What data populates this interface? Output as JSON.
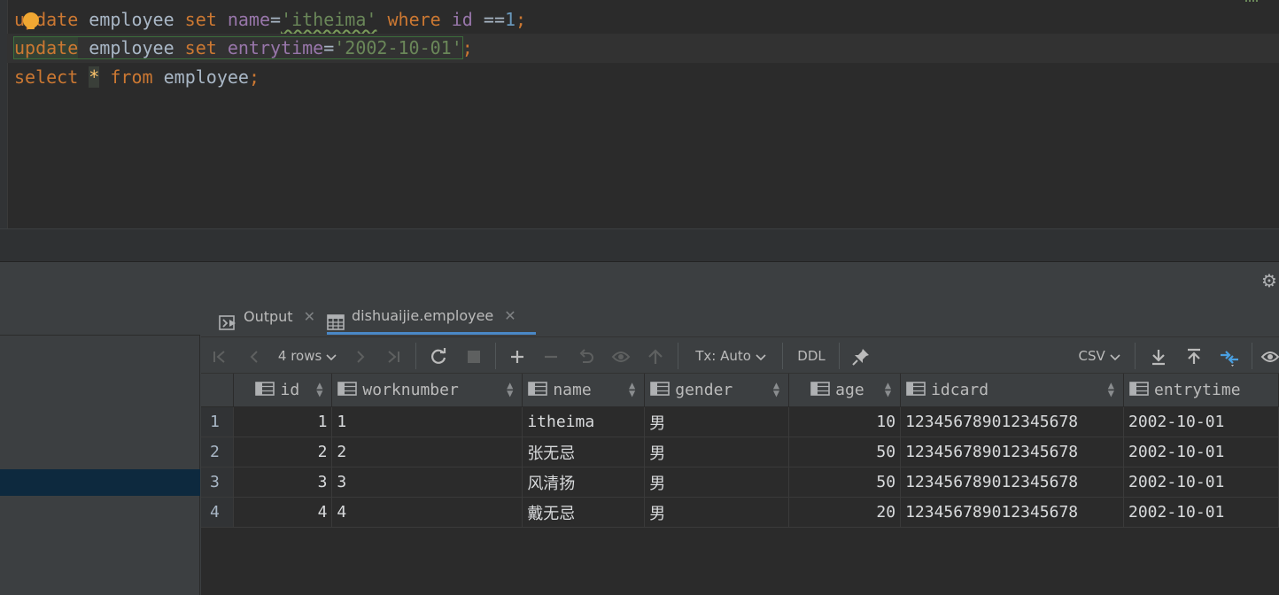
{
  "editor": {
    "lines": [
      {
        "kw1": "update",
        "table": "employee",
        "kw2": "set",
        "col": "name",
        "eq": "=",
        "str": "'itheima'",
        "kw3": "where",
        "col2": "id",
        "op": " =",
        "num": "1",
        "end": ";"
      },
      {
        "kw1": "update",
        "table": "employee",
        "kw2": "set",
        "col": "entrytime",
        "eq": "=",
        "str": "'2002-10-01'",
        "end": ";"
      },
      {
        "kw1": "select",
        "star": "*",
        "kw2": "from",
        "table": "employee",
        "end": ";"
      }
    ]
  },
  "results": {
    "tabs": [
      {
        "label": "Output",
        "icon": "console-icon"
      },
      {
        "label": "dishuaijie.employee",
        "icon": "table-icon",
        "active": true
      }
    ],
    "toolbar": {
      "rows_label": "4 rows",
      "tx_label": "Tx: Auto",
      "ddl_label": "DDL",
      "export_label": "CSV"
    },
    "columns": [
      "id",
      "worknumber",
      "name",
      "gender",
      "age",
      "idcard",
      "entrytime"
    ],
    "rows": [
      {
        "rn": "1",
        "id": "1",
        "worknumber": "1",
        "name": "itheima",
        "gender": "男",
        "age": "10",
        "idcard": "123456789012345678",
        "entrytime": "2002-10-01"
      },
      {
        "rn": "2",
        "id": "2",
        "worknumber": "2",
        "name": "张无忌",
        "gender": "男",
        "age": "50",
        "idcard": "123456789012345678",
        "entrytime": "2002-10-01"
      },
      {
        "rn": "3",
        "id": "3",
        "worknumber": "3",
        "name": "风清扬",
        "gender": "男",
        "age": "50",
        "idcard": "123456789012345678",
        "entrytime": "2002-10-01"
      },
      {
        "rn": "4",
        "id": "4",
        "worknumber": "4",
        "name": "戴无忌",
        "gender": "男",
        "age": "20",
        "idcard": "123456789012345678",
        "entrytime": "2002-10-01"
      }
    ]
  },
  "colors": {
    "keyword": "#cc7832",
    "string": "#6a8759",
    "column": "#9876aa",
    "number": "#6897bb",
    "accent": "#4a88c7",
    "selection": "#0d293e"
  }
}
